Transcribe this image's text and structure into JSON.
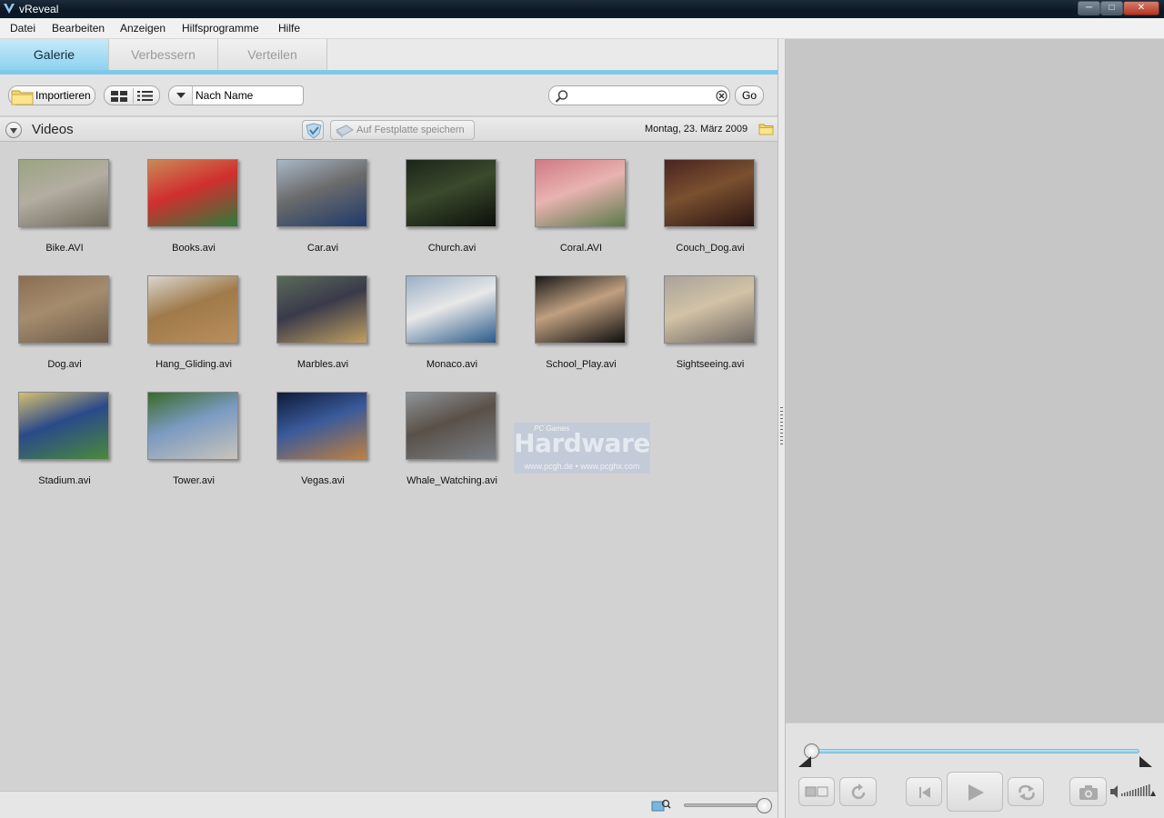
{
  "window": {
    "title": "vReveal"
  },
  "menu": [
    "Datei",
    "Bearbeiten",
    "Anzeigen",
    "Hilfsprogramme",
    "Hilfe"
  ],
  "tabs": [
    {
      "label": "Galerie",
      "active": true
    },
    {
      "label": "Verbessern",
      "active": false
    },
    {
      "label": "Verteilen",
      "active": false
    }
  ],
  "toolbar": {
    "import_label": "Importieren",
    "sort_value": "Nach Name",
    "search_value": "",
    "go_label": "Go"
  },
  "section": {
    "title": "Videos",
    "save_label": "Auf Festplatte speichern",
    "date": "Montag, 23. März 2009"
  },
  "videos": [
    {
      "name": "Bike.AVI",
      "colors": [
        "#9aa57f",
        "#6f6a5a",
        "#b3ada2"
      ]
    },
    {
      "name": "Books.avi",
      "colors": [
        "#c98a57",
        "#2e7a3b",
        "#d12f2f"
      ]
    },
    {
      "name": "Car.avi",
      "colors": [
        "#a9b8c8",
        "#1f3a6a",
        "#6b6b6b"
      ]
    },
    {
      "name": "Church.avi",
      "colors": [
        "#1d241a",
        "#0c0f0b",
        "#3a4a2c"
      ]
    },
    {
      "name": "Coral.AVI",
      "colors": [
        "#d07a85",
        "#5a7a4a",
        "#e8b3b0"
      ]
    },
    {
      "name": "Couch_Dog.avi",
      "colors": [
        "#4a2420",
        "#2a1512",
        "#7a5030"
      ]
    },
    {
      "name": "Dog.avi",
      "colors": [
        "#8a6e52",
        "#6a5a48",
        "#a68c6e"
      ]
    },
    {
      "name": "Hang_Gliding.avi",
      "colors": [
        "#d9d6cf",
        "#b98e5c",
        "#a07a4a"
      ]
    },
    {
      "name": "Marbles.avi",
      "colors": [
        "#5a6a5a",
        "#c0a060",
        "#3a3a4a"
      ]
    },
    {
      "name": "Monaco.avi",
      "colors": [
        "#9ab0c6",
        "#2a5a8a",
        "#e8e8e8"
      ]
    },
    {
      "name": "School_Play.avi",
      "colors": [
        "#1a1a1a",
        "#0e0e0e",
        "#c0a080"
      ]
    },
    {
      "name": "Sightseeing.avi",
      "colors": [
        "#a8a39a",
        "#6c6660",
        "#d2c2a6"
      ]
    },
    {
      "name": "Stadium.avi",
      "colors": [
        "#d6c070",
        "#4a8a3a",
        "#2a4a8a"
      ]
    },
    {
      "name": "Tower.avi",
      "colors": [
        "#3a6a2a",
        "#c9c4bc",
        "#7a9ac0"
      ]
    },
    {
      "name": "Vegas.avi",
      "colors": [
        "#0e1a3a",
        "#c08040",
        "#3a5a9a"
      ]
    },
    {
      "name": "Whale_Watching.avi",
      "colors": [
        "#8e9498",
        "#7a8086",
        "#5a5048"
      ]
    }
  ],
  "watermark": {
    "brand": "Hardware",
    "tag": "PC Games",
    "urls": "www.pcgh.de • www.pcghx.com"
  },
  "player": {
    "position": 0.0,
    "zoom": 1.0
  }
}
